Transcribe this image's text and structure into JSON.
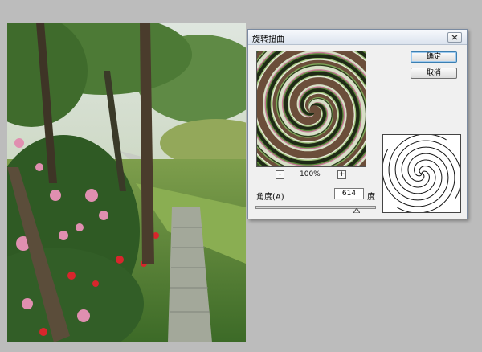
{
  "dialog": {
    "title": "旋转扭曲",
    "ok_label": "确定",
    "cancel_label": "取消",
    "zoom": {
      "minus_label": "-",
      "plus_label": "+",
      "value": "100%"
    },
    "angle": {
      "label": "角度(A)",
      "value": "614",
      "unit": "度",
      "slider_fraction": 0.853
    }
  },
  "colors": {
    "dialog_bg": "#f0f0f0",
    "ok_focus": "#3c7fb1"
  },
  "icons": {
    "close": "close-icon",
    "slider_thumb": "triangle-thumb-icon"
  }
}
